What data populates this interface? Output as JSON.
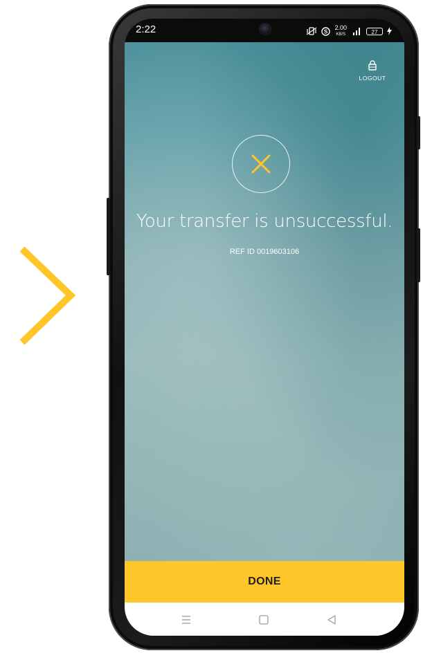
{
  "colors": {
    "accent": "#ffc629",
    "chevron": "#ffc629",
    "screen_teal": "#5f9ea7",
    "text_light": "#ffffff"
  },
  "status_bar": {
    "time": "2:22",
    "net_speed_value": "2.00",
    "net_speed_unit": "KB/S",
    "battery_level": "27",
    "icons": [
      "mute-vibrate-icon",
      "s-app-icon",
      "network-speed",
      "signal-icon",
      "battery-icon",
      "charging-icon"
    ]
  },
  "header": {
    "logout_label": "LOGOUT",
    "logout_icon": "lock-icon"
  },
  "result": {
    "status_icon": "close-icon",
    "message": "Your transfer is unsuccessful.",
    "ref_label": "REF ID 0019603106"
  },
  "actions": {
    "done_label": "DONE"
  },
  "nav": {
    "items": [
      "menu-icon",
      "home-icon",
      "back-icon"
    ]
  }
}
